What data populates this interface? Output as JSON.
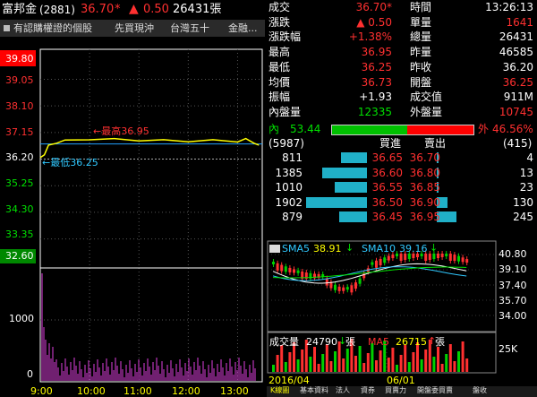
{
  "header": {
    "name": "富邦金",
    "code": "(2881)",
    "price": "36.70",
    "price_mark": "*",
    "change_arrow": "▲",
    "change": "0.50",
    "volume": "26431張"
  },
  "subtabs": [
    "有認購權證的個股",
    "先買現沖",
    "台灣五十",
    "金融..."
  ],
  "intraday": {
    "y_ticks": [
      "39.80",
      "39.05",
      "38.10",
      "37.15",
      "36.20",
      "35.25",
      "34.30",
      "33.35",
      "32.60"
    ],
    "vol_ticks": [
      "1000",
      "0"
    ],
    "x_ticks": [
      "9:00",
      "10:00",
      "11:00",
      "12:00",
      "13:00"
    ],
    "high_label": "←最高36.95",
    "low_label": "←最低36.25"
  },
  "quote": {
    "rows": [
      [
        "成交",
        "36.70*",
        "時間",
        "13:26:13"
      ],
      [
        "漲跌",
        "▲ 0.50",
        "單量",
        "1641"
      ],
      [
        "漲跌幅",
        "+1.38%",
        "總量",
        "26431"
      ],
      [
        "最高",
        "36.95",
        "昨量",
        "46585"
      ],
      [
        "最低",
        "36.25",
        "昨收",
        "36.20"
      ],
      [
        "均價",
        "36.73",
        "開盤",
        "36.25"
      ],
      [
        "振幅",
        "+1.93",
        "成交值",
        "911M"
      ],
      [
        "內盤量",
        "12335",
        "外盤量",
        "10745"
      ]
    ],
    "ratio_in_label": "內",
    "ratio_in_pct": "53.44",
    "ratio_out_label": "外",
    "ratio_out_pct": "46.56%"
  },
  "book": {
    "bid_total": "(5987)",
    "bid_header": "買進",
    "ask_header": "賣出",
    "ask_total": "(415)",
    "rows": [
      {
        "bid_vol": "811",
        "bid": "36.65",
        "ask": "36.70",
        "ask_vol": "4"
      },
      {
        "bid_vol": "1385",
        "bid": "36.60",
        "ask": "36.80",
        "ask_vol": "13"
      },
      {
        "bid_vol": "1010",
        "bid": "36.55",
        "ask": "36.85",
        "ask_vol": "23"
      },
      {
        "bid_vol": "1902",
        "bid": "36.50",
        "ask": "36.90",
        "ask_vol": "130"
      },
      {
        "bid_vol": "879",
        "bid": "36.45",
        "ask": "36.95",
        "ask_vol": "245"
      }
    ]
  },
  "kline": {
    "sma5_label": "SMA5",
    "sma5_value": "38.91",
    "sma10_label": "SMA10",
    "sma10_value": "39.16",
    "y_ticks": [
      "40.80",
      "39.10",
      "37.40",
      "35.70",
      "34.00"
    ],
    "vol_label": "成交量",
    "vol_value": "24790",
    "ma5_label": "MA5",
    "ma5_value": "26715",
    "vol_tick": "25K",
    "x_ticks": [
      "2016/04",
      "06/01"
    ]
  },
  "bottom_tabs": [
    "K線圖",
    "基本資料",
    "法人",
    "資券",
    "買賣力",
    "開盤委買賣",
    "盤收"
  ],
  "chart_data": {
    "type": "line",
    "title": "",
    "xlabel": "",
    "ylabel": "",
    "ylim": [
      32.6,
      39.8
    ],
    "x": [
      "9:00",
      "9:05",
      "9:10",
      "9:20",
      "9:30",
      "10:00",
      "10:30",
      "11:00",
      "11:30",
      "12:00",
      "12:30",
      "13:00",
      "13:10",
      "13:20",
      "13:26"
    ],
    "series": [
      {
        "values": [
          36.25,
          36.35,
          36.7,
          36.8,
          36.85,
          36.92,
          36.9,
          36.88,
          36.86,
          36.85,
          36.86,
          36.84,
          36.9,
          36.8,
          36.7
        ]
      }
    ],
    "high": 36.95,
    "low": 36.25,
    "prev_close": 36.2,
    "grid": true
  }
}
